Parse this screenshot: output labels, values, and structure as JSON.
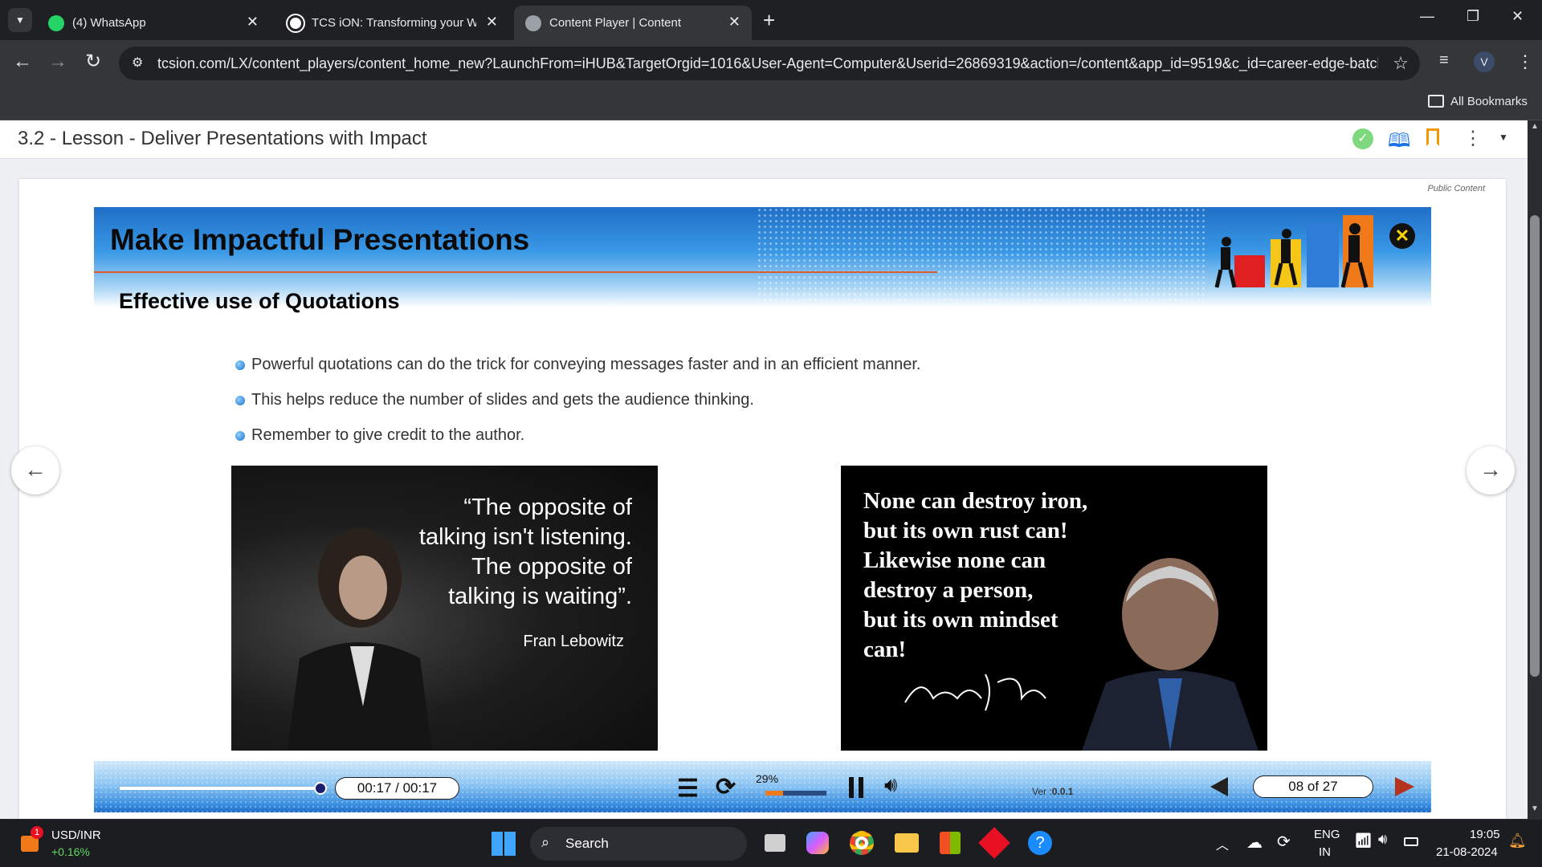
{
  "browser": {
    "tabs": [
      {
        "label": "(4) WhatsApp",
        "icon": "whatsapp-icon",
        "color": "#25d366"
      },
      {
        "label": "TCS iON: Transforming your Wo",
        "icon": "tcs-icon",
        "color": "#ffffff"
      },
      {
        "label": "Content Player | Content",
        "icon": "globe-icon",
        "color": "#9aa0a6"
      }
    ],
    "url": "tcsion.com/LX/content_players/content_home_new?LaunchFrom=iHUB&TargetOrgid=1016&User-Agent=Computer&Userid=26869319&action=/content&app_id=9519&c_id=career-edge-batch...",
    "profile_initial": "V",
    "bookmarks_label": "All Bookmarks"
  },
  "lesson": {
    "title": "3.2 - Lesson - Deliver Presentations with Impact",
    "public_label": "Public Content"
  },
  "slide": {
    "title": "Make Impactful Presentations",
    "subtitle": "Effective use of Quotations",
    "bullets": [
      "Powerful quotations can do the trick for conveying messages faster and in an efficient manner.",
      "This helps reduce the number of slides and gets the audience thinking.",
      "Remember to give credit to the author."
    ],
    "quote1": {
      "lines": [
        "“The opposite of",
        "talking isn't listening.",
        "The opposite of",
        "talking is waiting”."
      ],
      "author": "Fran Lebowitz"
    },
    "quote2": {
      "lines": [
        "None can destroy iron,",
        "but its own rust can!",
        "Likewise none can",
        "destroy a person,",
        "but its own mindset",
        "can!"
      ]
    }
  },
  "player": {
    "time": "00:17 / 00:17",
    "progress": 1.0,
    "buffer_percent": "29%",
    "buffer_fraction": 0.29,
    "version_label": "Ver :",
    "version": "0.0.1",
    "page": "08 of 27"
  },
  "taskbar": {
    "ticker_name": "USD/INR",
    "ticker_change": "+0.16%",
    "ticker_badge": "1",
    "search": "Search",
    "lang1": "ENG",
    "lang2": "IN",
    "time": "19:05",
    "date": "21-08-2024"
  },
  "colors": {
    "accent_green": "#4cd964",
    "book_blue": "#1a73e8",
    "bookmark_orange": "#f29900",
    "arrow_red": "#b5331e"
  }
}
